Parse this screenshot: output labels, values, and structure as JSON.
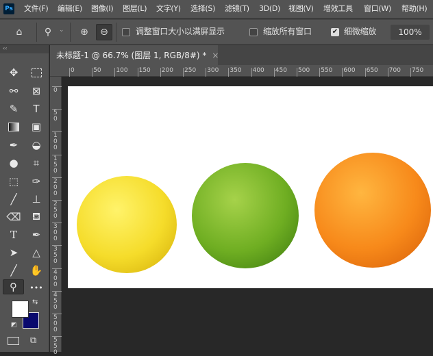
{
  "app": {
    "logo": "Ps"
  },
  "menu": [
    "文件(F)",
    "编辑(E)",
    "图像(I)",
    "图层(L)",
    "文字(Y)",
    "选择(S)",
    "滤镜(T)",
    "3D(D)",
    "视图(V)",
    "增效工具",
    "窗口(W)",
    "帮助(H)"
  ],
  "options": {
    "resize_windows": "调整窗口大小以满屏显示",
    "resize_checked": false,
    "zoom_all": "缩放所有窗口",
    "zoom_all_checked": false,
    "scrubby": "细微缩放",
    "scrubby_checked": true,
    "zoom_value": "100%"
  },
  "document": {
    "tab_title": "未标题-1 @ 66.7% (图层 1, RGB/8#) *",
    "close": "×"
  },
  "rulers": {
    "horizontal": [
      "0",
      "50",
      "100",
      "150",
      "200",
      "250",
      "300",
      "350",
      "400",
      "450",
      "500",
      "550",
      "600",
      "650",
      "700",
      "750"
    ],
    "vertical": [
      "0",
      "50",
      "100",
      "150",
      "200",
      "250",
      "300",
      "350",
      "400",
      "450",
      "500",
      "550"
    ]
  },
  "colors": {
    "foreground": "#ffffff",
    "background": "#0a0a6e",
    "ui": "#535353"
  },
  "toolbox": {
    "collapse": "‹‹",
    "active_tool": "zoom-tool"
  }
}
